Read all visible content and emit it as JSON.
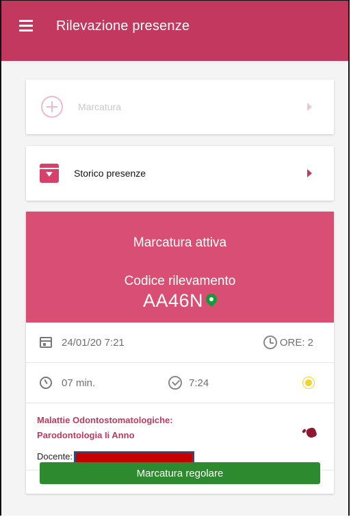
{
  "appbar": {
    "title": "Rilevazione presenze",
    "color": "#c2385f",
    "menu_icon": "menu-icon"
  },
  "actions": [
    {
      "label": "Marcatura",
      "icon": "add-circle-icon",
      "enabled": false
    },
    {
      "label": "Storico presenze",
      "icon": "archive-icon",
      "enabled": true
    }
  ],
  "active": {
    "heading": "Marcatura attiva",
    "code_label": "Codice rilevamento",
    "code": "AA46N",
    "hero_color": "#d94f74",
    "pin_icon": "location-pin-icon",
    "date_time": "24/01/20 7:21",
    "hours": "ORE: 2",
    "duration": "07 min.",
    "check_time": "7:24",
    "course_line1": "Malattie Odontostomatologiche:",
    "course_line2": "Parodontologia Ii Anno",
    "docente_label": "Docente:",
    "status_label": "Marcatura regolare",
    "status_color": "#2e8a2e"
  }
}
